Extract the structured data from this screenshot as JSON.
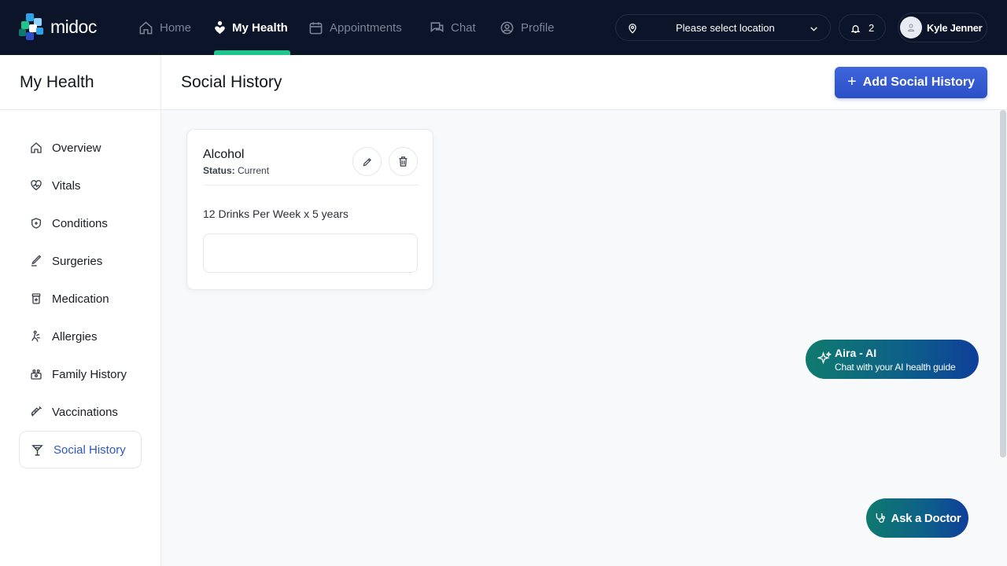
{
  "app": {
    "brand": "midoc"
  },
  "nav": {
    "items": [
      {
        "label": "Home",
        "icon": "home-icon"
      },
      {
        "label": "My Health",
        "icon": "health-icon",
        "active": true
      },
      {
        "label": "Appointments",
        "icon": "calendar-icon"
      },
      {
        "label": "Chat",
        "icon": "chat-icon"
      },
      {
        "label": "Profile",
        "icon": "profile-icon"
      }
    ],
    "location_placeholder": "Please select location",
    "notification_count": "2",
    "user_name": "Kyle Jenner"
  },
  "sidebar": {
    "title": "My Health",
    "items": [
      {
        "label": "Overview",
        "icon": "home-icon"
      },
      {
        "label": "Vitals",
        "icon": "heart-pulse-icon"
      },
      {
        "label": "Conditions",
        "icon": "shield-icon"
      },
      {
        "label": "Surgeries",
        "icon": "scalpel-icon"
      },
      {
        "label": "Medication",
        "icon": "pill-bottle-icon"
      },
      {
        "label": "Allergies",
        "icon": "allergy-icon"
      },
      {
        "label": "Family History",
        "icon": "family-icon"
      },
      {
        "label": "Vaccinations",
        "icon": "syringe-icon"
      },
      {
        "label": "Social History",
        "icon": "cocktail-icon",
        "active": true
      }
    ]
  },
  "main": {
    "title": "Social History",
    "add_button": "Add Social History",
    "cards": [
      {
        "title": "Alcohol",
        "status_label": "Status:",
        "status_value": "Current",
        "description": "12 Drinks Per Week x 5 years"
      }
    ]
  },
  "aira": {
    "title": "Aira - AI",
    "subtitle": "Chat with your AI health guide"
  },
  "ask_doctor": {
    "label": "Ask a Doctor"
  },
  "colors": {
    "nav_bg": "#0b1428",
    "accent_green": "#1fc58a",
    "primary_blue": "#2d56c4"
  }
}
